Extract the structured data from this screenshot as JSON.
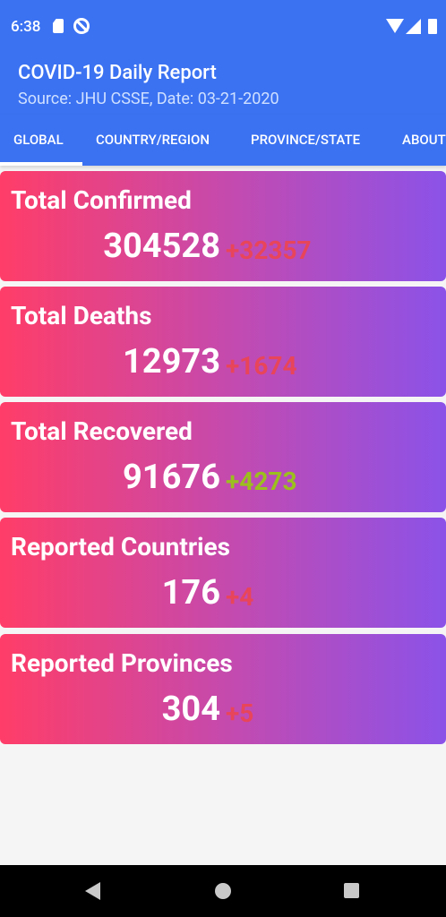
{
  "status": {
    "time": "6:38"
  },
  "app": {
    "title": "COVID-19 Daily Report",
    "subtitle": "Source: JHU CSSE, Date: 03-21-2020"
  },
  "tabs": [
    {
      "label": "GLOBAL",
      "selected": true
    },
    {
      "label": "COUNTRY/REGION",
      "selected": false
    },
    {
      "label": "PROVINCE/STATE",
      "selected": false
    },
    {
      "label": "ABOUT",
      "selected": false
    }
  ],
  "cards": [
    {
      "title": "Total Confirmed",
      "value": "304528",
      "delta": "+32357",
      "delta_color": "#e8455a"
    },
    {
      "title": "Total Deaths",
      "value": "12973",
      "delta": "+1674",
      "delta_color": "#e8455a"
    },
    {
      "title": "Total Recovered",
      "value": "91676",
      "delta": "+4273",
      "delta_color": "#9bbf1e"
    },
    {
      "title": "Reported Countries",
      "value": "176",
      "delta": "+4",
      "delta_color": "#e8455a"
    },
    {
      "title": "Reported Provinces",
      "value": "304",
      "delta": "+5",
      "delta_color": "#e8455a"
    }
  ],
  "colors": {
    "primary": "#3b72f2",
    "card_gradient_start": "#ff3d68",
    "card_gradient_end": "#8b52e8"
  },
  "icons": {
    "status": [
      "sd-card-icon",
      "no-disturb-icon",
      "wifi-icon",
      "signal-icon",
      "battery-icon"
    ],
    "nav": [
      "back-icon",
      "home-icon",
      "recents-icon"
    ]
  }
}
